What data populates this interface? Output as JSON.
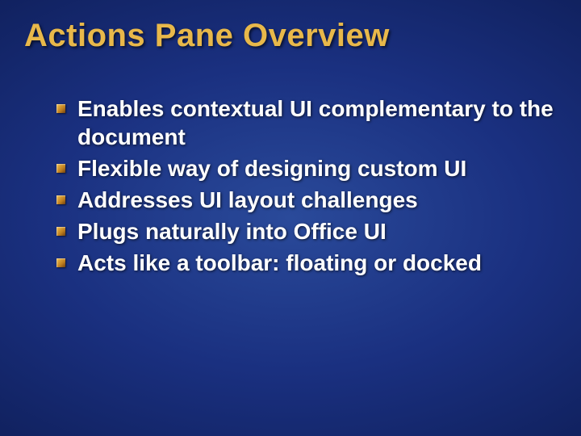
{
  "slide": {
    "title": "Actions Pane Overview",
    "bullets": [
      "Enables contextual UI complementary to the document",
      "Flexible way of designing custom UI",
      "Addresses UI layout challenges",
      "Plugs naturally into Office UI",
      "Acts like a toolbar: floating or docked"
    ]
  }
}
